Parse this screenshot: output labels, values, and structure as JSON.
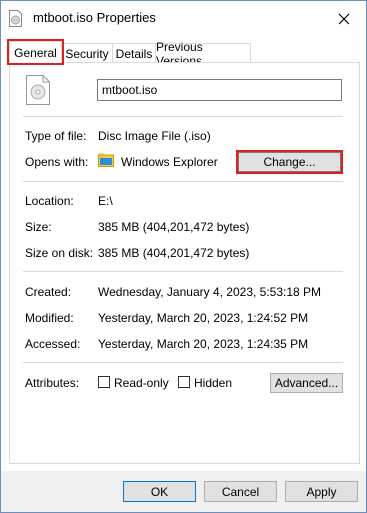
{
  "window": {
    "title": "mtboot.iso Properties"
  },
  "tabs": [
    {
      "label": "General"
    },
    {
      "label": "Security"
    },
    {
      "label": "Details"
    },
    {
      "label": "Previous Versions"
    }
  ],
  "general": {
    "file_name": "mtboot.iso",
    "type_label": "Type of file:",
    "type_value": "Disc Image File (.iso)",
    "opens_label": "Opens with:",
    "opens_value": "Windows Explorer",
    "change_label": "Change...",
    "location_label": "Location:",
    "location_value": "E:\\",
    "size_label": "Size:",
    "size_value": "385 MB (404,201,472 bytes)",
    "size_disk_label": "Size on disk:",
    "size_disk_value": "385 MB (404,201,472 bytes)",
    "created_label": "Created:",
    "created_value": "Wednesday, January 4, 2023, 5:53:18 PM",
    "modified_label": "Modified:",
    "modified_value": "Yesterday, March 20, 2023, 1:24:52 PM",
    "accessed_label": "Accessed:",
    "accessed_value": "Yesterday, March 20, 2023, 1:24:35 PM",
    "attributes_label": "Attributes:",
    "readonly_label": "Read-only",
    "hidden_label": "Hidden",
    "advanced_label": "Advanced..."
  },
  "footer": {
    "ok": "OK",
    "cancel": "Cancel",
    "apply": "Apply"
  },
  "colors": {
    "highlight": "#e02020",
    "border": "#6d8fb9"
  },
  "icons": [
    "disc-file-icon",
    "close-icon",
    "windows-explorer-icon"
  ]
}
